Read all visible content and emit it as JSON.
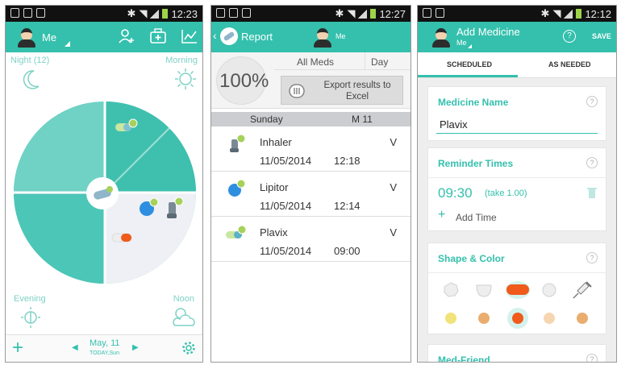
{
  "phone1": {
    "status": {
      "time": "12:23"
    },
    "appbar": {
      "user": "Me"
    },
    "labels": {
      "night": "Night (12)",
      "morning": "Morning",
      "evening": "Evening",
      "noon": "Noon"
    },
    "footer": {
      "date": "May, 11",
      "subdate": "TODAY,Sun"
    }
  },
  "phone2": {
    "status": {
      "time": "12:27"
    },
    "appbar": {
      "title": "Report",
      "user": "Me"
    },
    "summary": {
      "percent": "100%",
      "filter_all": "All Meds",
      "filter_day": "Day",
      "export_label": "Export results to Excel"
    },
    "day_header": {
      "day": "Sunday",
      "meta": "M 11"
    },
    "entries": [
      {
        "name": "Inhaler",
        "date": "11/05/2014",
        "time": "12:18",
        "mark": "V"
      },
      {
        "name": "Lipitor",
        "date": "11/05/2014",
        "time": "12:14",
        "mark": "V"
      },
      {
        "name": "Plavix",
        "date": "11/05/2014",
        "time": "09:00",
        "mark": "V"
      }
    ]
  },
  "phone3": {
    "status": {
      "time": "12:12"
    },
    "appbar": {
      "title": "Add Medicine",
      "user": "Me",
      "save": "SAVE"
    },
    "tabs": {
      "scheduled": "SCHEDULED",
      "as_needed": "AS NEEDED"
    },
    "medicine": {
      "title": "Medicine Name",
      "value": "Plavix"
    },
    "reminders": {
      "title": "Reminder Times",
      "time": "09:30",
      "take": "(take 1.00)",
      "add": "Add Time"
    },
    "shape": {
      "title": "Shape & Color"
    },
    "next_card": {
      "title": "Med-Friend"
    },
    "colors": {
      "teal": "#34c0ad",
      "orange": "#f05a1a",
      "yellow": "#f2e27a",
      "tan": "#e9ad6e"
    }
  }
}
